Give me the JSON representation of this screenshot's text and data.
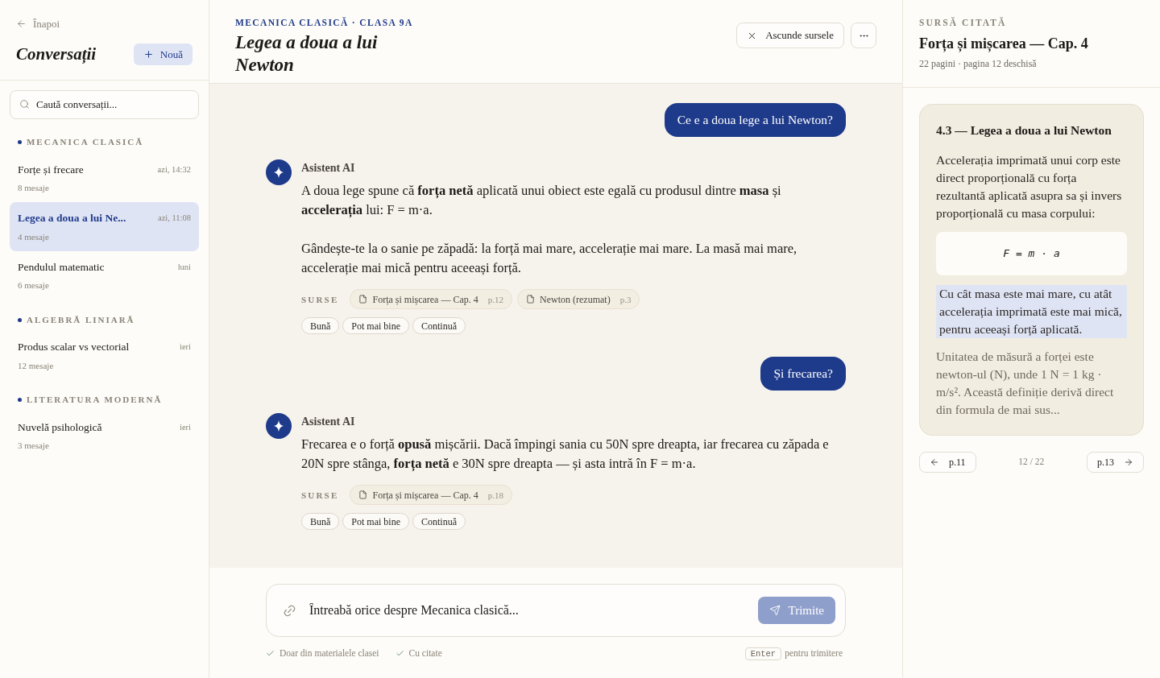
{
  "sidebar": {
    "back_link": "Înapoi",
    "title": "Conversații",
    "new_button": "Nouă",
    "search": {
      "placeholder": "Caută conversații..."
    },
    "groups": [
      {
        "name": "MECANICA CLASICĂ",
        "conversations": [
          {
            "title": "Forțe și frecare",
            "time": "azi, 14:32",
            "count": "8 mesaje",
            "selected": false
          },
          {
            "title": "Legea a doua a lui Ne...",
            "time": "azi, 11:08",
            "count": "4 mesaje",
            "selected": true
          },
          {
            "title": "Pendulul matematic",
            "time": "luni",
            "count": "6 mesaje",
            "selected": false
          }
        ]
      },
      {
        "name": "ALGEBRĂ LINIARĂ",
        "conversations": [
          {
            "title": "Produs scalar vs vectorial",
            "time": "ieri",
            "count": "12 mesaje",
            "selected": false
          }
        ]
      },
      {
        "name": "LITERATURA MODERNĂ",
        "conversations": [
          {
            "title": "Nuvelă psihologică",
            "time": "ieri",
            "count": "3 mesaje",
            "selected": false
          }
        ]
      }
    ]
  },
  "header": {
    "eyebrow": "MECANICA CLASICĂ · CLASA 9A",
    "title": "Legea a doua a lui Newton",
    "hide_sources_button": "Ascunde sursele"
  },
  "messages": [
    {
      "kind": "user",
      "text": "Ce e a doua lege a lui Newton?"
    },
    {
      "kind": "assistant",
      "author": "Asistent AI",
      "paragraphs": [
        "A doua lege spune că **forța netă** aplicată unui obiect este egală cu produsul dintre **masa** și **accelerația** lui: F = m·a.",
        "Gândește-te la o sanie pe zăpadă: la forță mai mare, accelerație mai mare. La masă mai mare, accelerație mai mică pentru aceeași forță."
      ],
      "sources_label": "SURSE",
      "sources": [
        {
          "title": "Forța și mișcarea — Cap. 4",
          "page": "p.12"
        },
        {
          "title": "Newton (rezumat)",
          "page": "p.3"
        }
      ],
      "reactions": [
        "Bună",
        "Pot mai bine",
        "Continuă"
      ]
    },
    {
      "kind": "user",
      "text": "Și frecarea?"
    },
    {
      "kind": "assistant",
      "author": "Asistent AI",
      "paragraphs": [
        "Frecarea e o forță **opusă** mișcării. Dacă împingi sania cu 50N spre dreapta, iar frecarea cu zăpada e 20N spre stânga, **forța netă** e 30N spre dreapta — și asta intră în F = m·a."
      ],
      "sources_label": "SURSE",
      "sources": [
        {
          "title": "Forța și mișcarea — Cap. 4",
          "page": "p.18"
        }
      ],
      "reactions": [
        "Bună",
        "Pot mai bine",
        "Continuă"
      ]
    }
  ],
  "composer": {
    "placeholder": "Întreabă orice despre Mecanica clasică...",
    "send_button": {
      "label": "Trimite",
      "disabled": true
    },
    "options": [
      {
        "label": "Doar din materialele clasei",
        "checked": true
      },
      {
        "label": "Cu citate",
        "checked": true
      }
    ],
    "hint_key": "Enter",
    "hint_text": "pentru trimitere"
  },
  "source_panel": {
    "eyebrow": "SURSĂ CITATĂ",
    "title": "Forța și mișcarea — Cap. 4",
    "meta": "22 pagini · pagina 12 deschisă",
    "card": {
      "heading": "4.3 — Legea a doua a lui Newton",
      "blocks": [
        {
          "kind": "text",
          "text": "Accelerația imprimată unui corp este direct proporțională cu forța rezultantă aplicată asupra sa și invers proporțională cu masa corpului:"
        },
        {
          "kind": "formula",
          "text": "F = m · a"
        },
        {
          "kind": "highlight",
          "text": "Cu cât masa este mai mare, cu atât accelerația imprimată este mai mică, pentru aceeași forță aplicată."
        },
        {
          "kind": "muted",
          "text": "Unitatea de măsură a forței este newton-ul (N), unde 1 N = 1 kg · m/s². Această definiție derivă direct din formula de mai sus..."
        }
      ]
    },
    "pager": {
      "prev": "p.11",
      "position": "12 / 22",
      "next": "p.13"
    }
  }
}
